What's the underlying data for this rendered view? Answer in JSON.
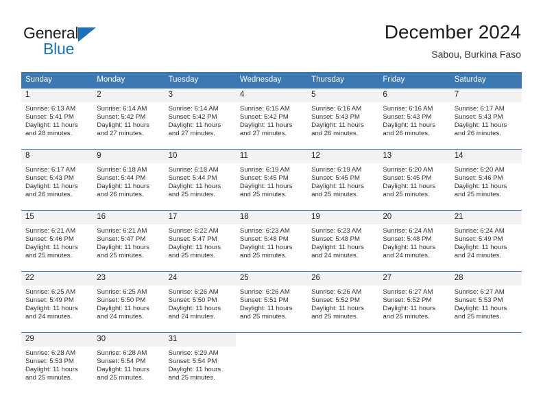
{
  "brand": {
    "name_top": "General",
    "name_bottom": "Blue",
    "accent_color": "#1b72bb"
  },
  "header": {
    "title": "December 2024",
    "subtitle": "Sabou, Burkina Faso"
  },
  "theme": {
    "header_blue": "#3c78b4",
    "daynum_background": "#f2f2f2",
    "text_color": "#222222"
  },
  "weekdays": [
    "Sunday",
    "Monday",
    "Tuesday",
    "Wednesday",
    "Thursday",
    "Friday",
    "Saturday"
  ],
  "weeks": [
    [
      {
        "day": "1",
        "sunrise": "Sunrise: 6:13 AM",
        "sunset": "Sunset: 5:41 PM",
        "daylight1": "Daylight: 11 hours",
        "daylight2": "and 28 minutes."
      },
      {
        "day": "2",
        "sunrise": "Sunrise: 6:14 AM",
        "sunset": "Sunset: 5:42 PM",
        "daylight1": "Daylight: 11 hours",
        "daylight2": "and 27 minutes."
      },
      {
        "day": "3",
        "sunrise": "Sunrise: 6:14 AM",
        "sunset": "Sunset: 5:42 PM",
        "daylight1": "Daylight: 11 hours",
        "daylight2": "and 27 minutes."
      },
      {
        "day": "4",
        "sunrise": "Sunrise: 6:15 AM",
        "sunset": "Sunset: 5:42 PM",
        "daylight1": "Daylight: 11 hours",
        "daylight2": "and 27 minutes."
      },
      {
        "day": "5",
        "sunrise": "Sunrise: 6:16 AM",
        "sunset": "Sunset: 5:43 PM",
        "daylight1": "Daylight: 11 hours",
        "daylight2": "and 26 minutes."
      },
      {
        "day": "6",
        "sunrise": "Sunrise: 6:16 AM",
        "sunset": "Sunset: 5:43 PM",
        "daylight1": "Daylight: 11 hours",
        "daylight2": "and 26 minutes."
      },
      {
        "day": "7",
        "sunrise": "Sunrise: 6:17 AM",
        "sunset": "Sunset: 5:43 PM",
        "daylight1": "Daylight: 11 hours",
        "daylight2": "and 26 minutes."
      }
    ],
    [
      {
        "day": "8",
        "sunrise": "Sunrise: 6:17 AM",
        "sunset": "Sunset: 5:43 PM",
        "daylight1": "Daylight: 11 hours",
        "daylight2": "and 26 minutes."
      },
      {
        "day": "9",
        "sunrise": "Sunrise: 6:18 AM",
        "sunset": "Sunset: 5:44 PM",
        "daylight1": "Daylight: 11 hours",
        "daylight2": "and 26 minutes."
      },
      {
        "day": "10",
        "sunrise": "Sunrise: 6:18 AM",
        "sunset": "Sunset: 5:44 PM",
        "daylight1": "Daylight: 11 hours",
        "daylight2": "and 25 minutes."
      },
      {
        "day": "11",
        "sunrise": "Sunrise: 6:19 AM",
        "sunset": "Sunset: 5:45 PM",
        "daylight1": "Daylight: 11 hours",
        "daylight2": "and 25 minutes."
      },
      {
        "day": "12",
        "sunrise": "Sunrise: 6:19 AM",
        "sunset": "Sunset: 5:45 PM",
        "daylight1": "Daylight: 11 hours",
        "daylight2": "and 25 minutes."
      },
      {
        "day": "13",
        "sunrise": "Sunrise: 6:20 AM",
        "sunset": "Sunset: 5:45 PM",
        "daylight1": "Daylight: 11 hours",
        "daylight2": "and 25 minutes."
      },
      {
        "day": "14",
        "sunrise": "Sunrise: 6:20 AM",
        "sunset": "Sunset: 5:46 PM",
        "daylight1": "Daylight: 11 hours",
        "daylight2": "and 25 minutes."
      }
    ],
    [
      {
        "day": "15",
        "sunrise": "Sunrise: 6:21 AM",
        "sunset": "Sunset: 5:46 PM",
        "daylight1": "Daylight: 11 hours",
        "daylight2": "and 25 minutes."
      },
      {
        "day": "16",
        "sunrise": "Sunrise: 6:21 AM",
        "sunset": "Sunset: 5:47 PM",
        "daylight1": "Daylight: 11 hours",
        "daylight2": "and 25 minutes."
      },
      {
        "day": "17",
        "sunrise": "Sunrise: 6:22 AM",
        "sunset": "Sunset: 5:47 PM",
        "daylight1": "Daylight: 11 hours",
        "daylight2": "and 25 minutes."
      },
      {
        "day": "18",
        "sunrise": "Sunrise: 6:23 AM",
        "sunset": "Sunset: 5:48 PM",
        "daylight1": "Daylight: 11 hours",
        "daylight2": "and 25 minutes."
      },
      {
        "day": "19",
        "sunrise": "Sunrise: 6:23 AM",
        "sunset": "Sunset: 5:48 PM",
        "daylight1": "Daylight: 11 hours",
        "daylight2": "and 24 minutes."
      },
      {
        "day": "20",
        "sunrise": "Sunrise: 6:24 AM",
        "sunset": "Sunset: 5:48 PM",
        "daylight1": "Daylight: 11 hours",
        "daylight2": "and 24 minutes."
      },
      {
        "day": "21",
        "sunrise": "Sunrise: 6:24 AM",
        "sunset": "Sunset: 5:49 PM",
        "daylight1": "Daylight: 11 hours",
        "daylight2": "and 24 minutes."
      }
    ],
    [
      {
        "day": "22",
        "sunrise": "Sunrise: 6:25 AM",
        "sunset": "Sunset: 5:49 PM",
        "daylight1": "Daylight: 11 hours",
        "daylight2": "and 24 minutes."
      },
      {
        "day": "23",
        "sunrise": "Sunrise: 6:25 AM",
        "sunset": "Sunset: 5:50 PM",
        "daylight1": "Daylight: 11 hours",
        "daylight2": "and 24 minutes."
      },
      {
        "day": "24",
        "sunrise": "Sunrise: 6:26 AM",
        "sunset": "Sunset: 5:50 PM",
        "daylight1": "Daylight: 11 hours",
        "daylight2": "and 24 minutes."
      },
      {
        "day": "25",
        "sunrise": "Sunrise: 6:26 AM",
        "sunset": "Sunset: 5:51 PM",
        "daylight1": "Daylight: 11 hours",
        "daylight2": "and 25 minutes."
      },
      {
        "day": "26",
        "sunrise": "Sunrise: 6:26 AM",
        "sunset": "Sunset: 5:52 PM",
        "daylight1": "Daylight: 11 hours",
        "daylight2": "and 25 minutes."
      },
      {
        "day": "27",
        "sunrise": "Sunrise: 6:27 AM",
        "sunset": "Sunset: 5:52 PM",
        "daylight1": "Daylight: 11 hours",
        "daylight2": "and 25 minutes."
      },
      {
        "day": "28",
        "sunrise": "Sunrise: 6:27 AM",
        "sunset": "Sunset: 5:53 PM",
        "daylight1": "Daylight: 11 hours",
        "daylight2": "and 25 minutes."
      }
    ],
    [
      {
        "day": "29",
        "sunrise": "Sunrise: 6:28 AM",
        "sunset": "Sunset: 5:53 PM",
        "daylight1": "Daylight: 11 hours",
        "daylight2": "and 25 minutes."
      },
      {
        "day": "30",
        "sunrise": "Sunrise: 6:28 AM",
        "sunset": "Sunset: 5:54 PM",
        "daylight1": "Daylight: 11 hours",
        "daylight2": "and 25 minutes."
      },
      {
        "day": "31",
        "sunrise": "Sunrise: 6:29 AM",
        "sunset": "Sunset: 5:54 PM",
        "daylight1": "Daylight: 11 hours",
        "daylight2": "and 25 minutes."
      },
      {
        "day": "",
        "sunrise": "",
        "sunset": "",
        "daylight1": "",
        "daylight2": ""
      },
      {
        "day": "",
        "sunrise": "",
        "sunset": "",
        "daylight1": "",
        "daylight2": ""
      },
      {
        "day": "",
        "sunrise": "",
        "sunset": "",
        "daylight1": "",
        "daylight2": ""
      },
      {
        "day": "",
        "sunrise": "",
        "sunset": "",
        "daylight1": "",
        "daylight2": ""
      }
    ]
  ]
}
